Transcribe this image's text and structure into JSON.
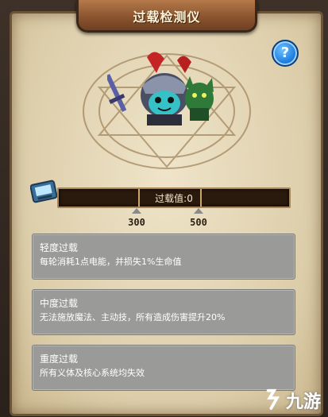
{
  "title": "过载检测仪",
  "help_label": "?",
  "overload": {
    "label": "过载值",
    "value": "0",
    "thresholds": [
      "300",
      "500"
    ]
  },
  "levels": [
    {
      "title": "轻度过载",
      "desc": "每轮消耗1点电能，并损失1%生命值"
    },
    {
      "title": "中度过载",
      "desc": "无法施放魔法、主动技，所有造成伤害提升20%"
    },
    {
      "title": "重度过载",
      "desc": "所有义体及核心系统均失效"
    }
  ],
  "watermark": "九游",
  "colors": {
    "panel": "#e8dcc0",
    "title_plate": "#8c5530",
    "card": "#9a9a98",
    "help": "#1f7fe0"
  }
}
